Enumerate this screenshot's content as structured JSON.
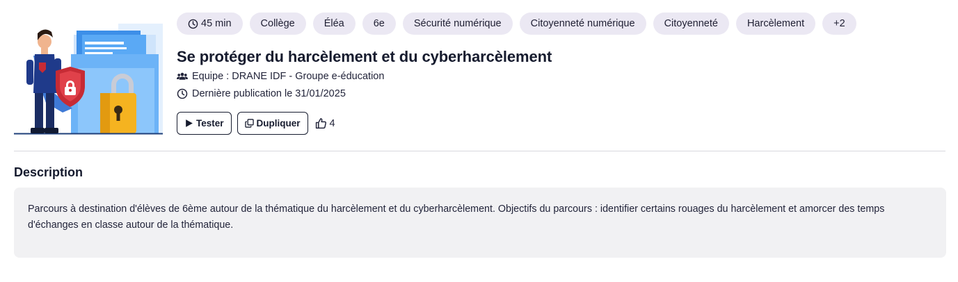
{
  "tags": [
    {
      "label": "45 min",
      "icon": "clock-icon"
    },
    {
      "label": "Collège"
    },
    {
      "label": "Éléa"
    },
    {
      "label": "6e"
    },
    {
      "label": "Sécurité numérique"
    },
    {
      "label": "Citoyenneté numérique"
    },
    {
      "label": "Citoyenneté"
    },
    {
      "label": "Harcèlement"
    },
    {
      "label": "+2"
    }
  ],
  "course": {
    "title": "Se protéger du harcèlement et du cyberharcèlement",
    "team": "Equipe : DRANE IDF - Groupe e-éducation",
    "published": "Dernière publication le 31/01/2025"
  },
  "actions": {
    "test_label": "Tester",
    "duplicate_label": "Dupliquer",
    "likes": "4"
  },
  "description": {
    "heading": "Description",
    "text": "Parcours à destination d'élèves de 6ème autour de la thématique du harcèlement et du cyberharcèlement. Objectifs du parcours : identifier certains rouages du harcèlement et amorcer des temps d'échanges en classe autour de la thématique."
  },
  "colors": {
    "tag_bg": "#ebe8f3",
    "text_dark": "#161b2e",
    "desc_bg": "#f1f1f3",
    "folder_blue": "#5aa9f5",
    "shield_red": "#c62b35",
    "lock_gold": "#f5b320"
  }
}
